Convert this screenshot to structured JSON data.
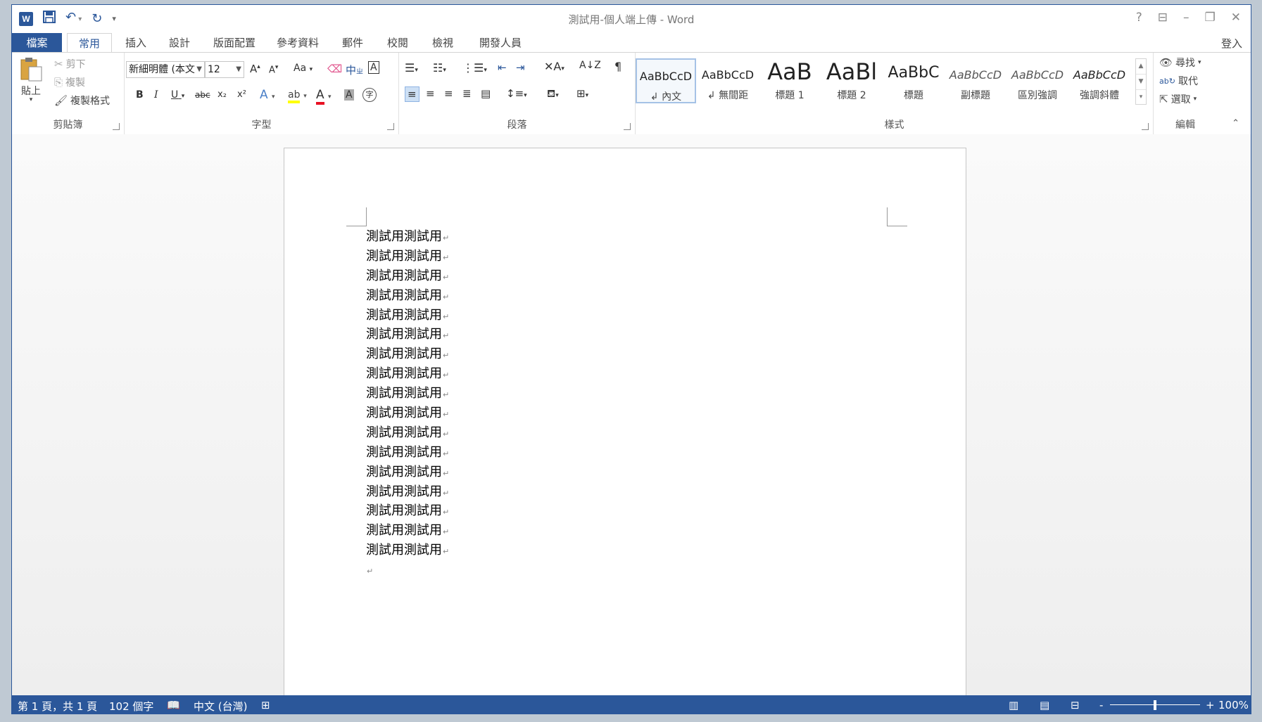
{
  "window": {
    "title": "測試用-個人端上傳 - Word"
  },
  "qat": {
    "word_logo": "W",
    "icons": [
      "word-icon",
      "save-icon",
      "undo-icon",
      "redo-icon",
      "customize-qat-icon"
    ]
  },
  "window_controls": {
    "help": "?",
    "ribbon_display": "⊟",
    "minimize": "–",
    "restore": "❐",
    "close": "✕"
  },
  "tabs": [
    {
      "label": "檔案"
    },
    {
      "label": "常用"
    },
    {
      "label": "插入"
    },
    {
      "label": "設計"
    },
    {
      "label": "版面配置"
    },
    {
      "label": "參考資料"
    },
    {
      "label": "郵件"
    },
    {
      "label": "校閱"
    },
    {
      "label": "檢視"
    },
    {
      "label": "開發人員"
    }
  ],
  "signin": "登入",
  "clipboard": {
    "label": "剪貼簿",
    "paste": "貼上",
    "cut": "剪下",
    "copy": "複製",
    "format_painter": "複製格式"
  },
  "font": {
    "label": "字型",
    "name": "新細明體 (本文",
    "size": "12",
    "grow": "A",
    "shrink": "A",
    "case": "Aa",
    "phonetic": "中",
    "border_char": "A",
    "bold": "B",
    "italic": "I",
    "underline": "U",
    "strike": "abc",
    "subscript": "x₂",
    "superscript": "x²",
    "effects": "A",
    "font_color": "A",
    "shade": "A",
    "enclose": "字"
  },
  "paragraph": {
    "label": "段落"
  },
  "styles": {
    "label": "樣式",
    "items": [
      {
        "sample": "AaBbCcD",
        "name": "↲ 內文"
      },
      {
        "sample": "AaBbCcD",
        "name": "↲ 無間距"
      },
      {
        "sample": "AaB",
        "name": "標題 1"
      },
      {
        "sample": "AaBl",
        "name": "標題 2"
      },
      {
        "sample": "AaBbC",
        "name": "標題"
      },
      {
        "sample": "AaBbCcD",
        "name": "副標題"
      },
      {
        "sample": "AaBbCcD",
        "name": "區別強調"
      },
      {
        "sample": "AaBbCcD",
        "name": "強調斜體"
      }
    ]
  },
  "editing": {
    "label": "編輯",
    "find": "尋找",
    "replace": "取代",
    "select": "選取"
  },
  "document": {
    "lines": [
      "測試用測試用",
      "測試用測試用",
      "測試用測試用",
      "測試用測試用",
      "測試用測試用",
      "測試用測試用",
      "測試用測試用",
      "測試用測試用",
      "測試用測試用",
      "測試用測試用",
      "測試用測試用",
      "測試用測試用",
      "測試用測試用",
      "測試用測試用",
      "測試用測試用",
      "測試用測試用",
      "測試用測試用",
      ""
    ],
    "para_mark": "↵"
  },
  "status": {
    "page": "第 1 頁，共 1 頁",
    "words": "102 個字",
    "language": "中文 (台灣)",
    "zoom": "100%",
    "zoom_level": 0.5,
    "zoom_minus": "-",
    "zoom_plus": "+"
  },
  "colors": {
    "accent": "#2b579a",
    "highlight": "#ffff00",
    "font_color": "#e81123"
  }
}
